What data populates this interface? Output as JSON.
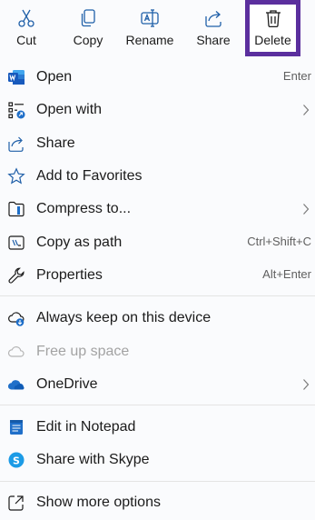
{
  "toolbar": {
    "cut_label": "Cut",
    "copy_label": "Copy",
    "rename_label": "Rename",
    "share_label": "Share",
    "delete_label": "Delete",
    "highlight_color": "#5b2f9e"
  },
  "items": [
    {
      "label": "Open",
      "shortcut": "Enter",
      "icon": "word-icon"
    },
    {
      "label": "Open with",
      "icon": "open-with-icon",
      "submenu": true
    },
    {
      "label": "Share",
      "icon": "share-icon"
    },
    {
      "label": "Add to Favorites",
      "icon": "star-icon"
    },
    {
      "label": "Compress to...",
      "icon": "zip-icon",
      "submenu": true
    },
    {
      "label": "Copy as path",
      "shortcut": "Ctrl+Shift+C",
      "icon": "copy-path-icon"
    },
    {
      "label": "Properties",
      "shortcut": "Alt+Enter",
      "icon": "wrench-icon"
    },
    {
      "label": "Always keep on this device",
      "icon": "cloud-download-icon"
    },
    {
      "label": "Free up space",
      "icon": "cloud-icon",
      "disabled": true
    },
    {
      "label": "OneDrive",
      "icon": "onedrive-icon",
      "submenu": true
    },
    {
      "label": "Edit in Notepad",
      "icon": "notepad-icon"
    },
    {
      "label": "Share with Skype",
      "icon": "skype-icon"
    },
    {
      "label": "Show more options",
      "icon": "show-more-icon"
    }
  ]
}
